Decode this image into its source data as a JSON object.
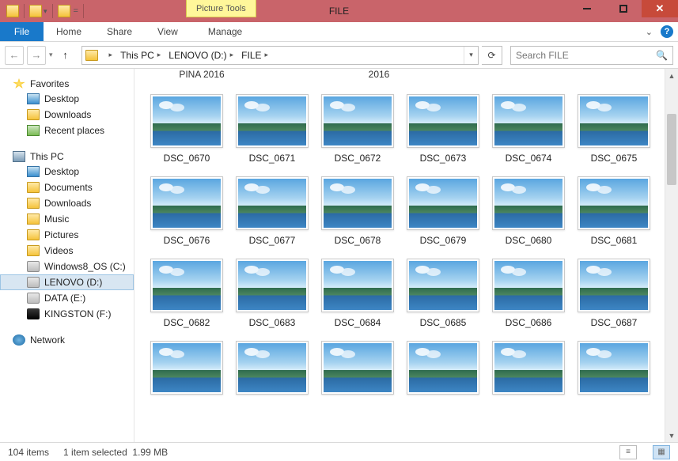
{
  "titlebar": {
    "context_tab": "Picture Tools",
    "title": "FILE"
  },
  "ribbon": {
    "file": "File",
    "tabs": [
      "Home",
      "Share",
      "View",
      "Manage"
    ]
  },
  "nav": {
    "breadcrumb": [
      "This PC",
      "LENOVO (D:)",
      "FILE"
    ],
    "search_placeholder": "Search FILE"
  },
  "tree": {
    "favorites": {
      "label": "Favorites",
      "items": [
        "Desktop",
        "Downloads",
        "Recent places"
      ]
    },
    "thispc": {
      "label": "This PC",
      "items": [
        "Desktop",
        "Documents",
        "Downloads",
        "Music",
        "Pictures",
        "Videos",
        "Windows8_OS (C:)",
        "LENOVO (D:)",
        "DATA (E:)",
        "KINGSTON (F:)"
      ]
    },
    "network": {
      "label": "Network"
    }
  },
  "partial_labels": [
    "PINA 2016",
    "2016"
  ],
  "files": [
    "DSC_0670",
    "DSC_0671",
    "DSC_0672",
    "DSC_0673",
    "DSC_0674",
    "DSC_0675",
    "DSC_0676",
    "DSC_0677",
    "DSC_0678",
    "DSC_0679",
    "DSC_0680",
    "DSC_0681",
    "DSC_0682",
    "DSC_0683",
    "DSC_0684",
    "DSC_0685",
    "DSC_0686",
    "DSC_0687",
    "",
    "",
    "",
    "",
    "",
    ""
  ],
  "status": {
    "count": "104 items",
    "selected": "1 item selected",
    "size": "1.99 MB"
  }
}
